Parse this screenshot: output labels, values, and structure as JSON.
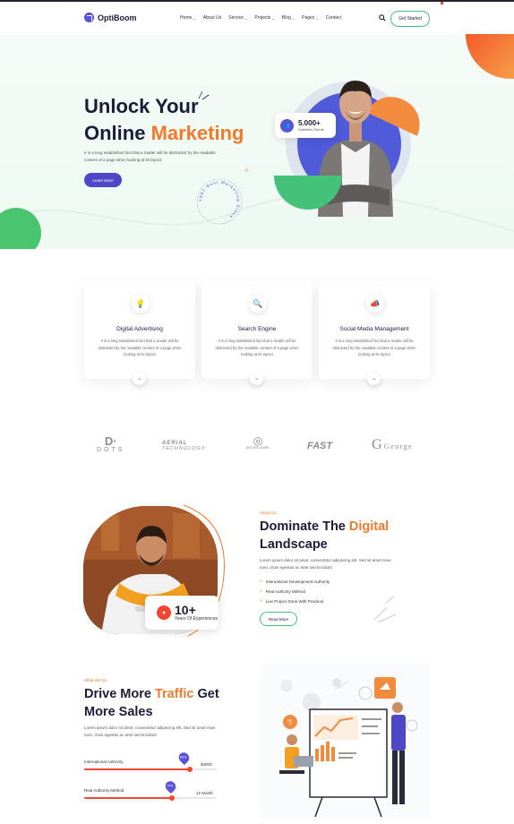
{
  "brand": {
    "name": "OptiBoom"
  },
  "nav": {
    "items": [
      {
        "label": "Home",
        "dropdown": true
      },
      {
        "label": "About Us",
        "dropdown": false
      },
      {
        "label": "Service",
        "dropdown": true
      },
      {
        "label": "Projects",
        "dropdown": true
      },
      {
        "label": "Blog",
        "dropdown": true
      },
      {
        "label": "Pages",
        "dropdown": true
      },
      {
        "label": "Contact",
        "dropdown": false
      }
    ],
    "cta": "Get Started"
  },
  "hero": {
    "title_line1": "Unlock Your",
    "title_line2_plain": "Online ",
    "title_line2_accent": "Marketing",
    "description": "It is a long established fact that a reader will be distracted by the readable content of a page when looking at its layout",
    "button": "Learn More",
    "stat_value": "5.000+",
    "stat_label": "Satisfied Clients",
    "badge_text": "1997 Best Marketing Since"
  },
  "services": [
    {
      "title": "Digital Advertising",
      "description": "It is a long established fact that a reader will be distracted by the readable content of a page when looking at its layout",
      "icon": "bulb-icon"
    },
    {
      "title": "Search Engine",
      "description": "It is a long established fact that a reader will be distracted by the readable content of a page when looking at its layout",
      "icon": "magnifier-icon"
    },
    {
      "title": "Social Media Management",
      "description": "It is a long established fact that a reader will be distracted by the readable content of a page when looking at its layout",
      "icon": "megaphone-icon"
    }
  ],
  "brands": [
    {
      "name": "DOTS",
      "mark": "D·"
    },
    {
      "name": "AERIAL",
      "sub": "TECHNOLOGY"
    },
    {
      "name": "NATURE SWIRL"
    },
    {
      "name": "FAST"
    },
    {
      "name": "George",
      "mark": "G"
    }
  ],
  "about": {
    "eyebrow": "About Us",
    "title_plain1": "Dominate The ",
    "title_accent": "Digital",
    "title_line2": "Landscape",
    "description": "Lorem ipsum dolor sit amet, consectetur adipiscing elit. Sed sit amet risus nunc. Duis egestas ac ante sed tincidunt",
    "features": [
      "International Development Authority",
      "Real Authority Method",
      "Live Project Done With Practical"
    ],
    "button": "Read More",
    "exp_value": "10+",
    "exp_label": "Years Of Experiences"
  },
  "whatwedo": {
    "eyebrow": "What We Do",
    "title_plain1": "Drive More ",
    "title_accent": "Traffic",
    "title_plain2": " Get",
    "title_line2": "More Sales",
    "description": "Lorem ipsum dolor sit amet, consectetur adipiscing elit. Sed sit amet risus nunc. Duis egestas ac ante sed tincidunt",
    "progress": [
      {
        "label": "International Authority",
        "value_text": "$4000",
        "pin": "80%",
        "fraction": 0.8
      },
      {
        "label": "Real Authority Method",
        "value_text": "12 Month",
        "pin": "70%",
        "fraction": 0.66
      }
    ]
  },
  "colors": {
    "primary": "#4f46c8",
    "accent": "#f27a2a",
    "green": "#45c27a",
    "red": "#f3462e",
    "dark": "#1c1c3a"
  }
}
